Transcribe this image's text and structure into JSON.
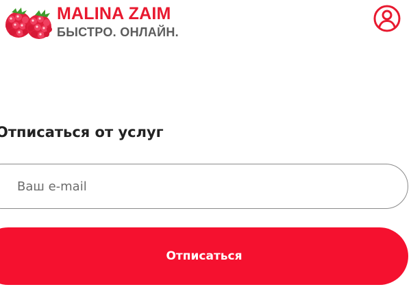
{
  "header": {
    "logo": {
      "title": "MALINA ZAIM",
      "tagline": "БЫСТРО. ОНЛАЙН.",
      "icon": "raspberry-icon"
    },
    "user_icon": "user-account-icon"
  },
  "form": {
    "title": "Отписаться от услуг",
    "email": {
      "placeholder": "Ваш e-mail",
      "value": ""
    },
    "submit_label": "Отписаться"
  },
  "colors": {
    "brand_red": "#e8192f",
    "button_red": "#f5112f",
    "tagline_gray": "#5b5b5b",
    "text_dark": "#222222",
    "input_border": "#8a8a8a"
  }
}
